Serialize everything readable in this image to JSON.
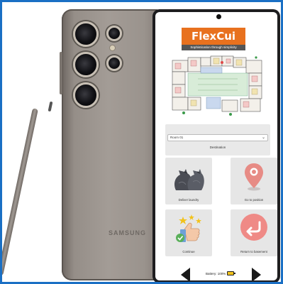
{
  "device": {
    "brand_text": "SAMSUNG"
  },
  "app": {
    "logo": {
      "title": "FlexCui",
      "tagline": "Sophistication through simplicity",
      "accent": "#e8711e"
    },
    "destination": {
      "selected": "Room 01",
      "label": "Destination"
    },
    "tiles": [
      {
        "label": "Deliver laundry",
        "icon": "laundry-bags-icon"
      },
      {
        "label": "Go to position",
        "icon": "location-pin-icon"
      },
      {
        "label": "Continue",
        "icon": "thumbs-up-stars-icon"
      },
      {
        "label": "Return to basement",
        "icon": "return-arrow-icon"
      }
    ],
    "footer": {
      "battery_text": "Battery: 100%",
      "battery_level": 1.0
    }
  },
  "colors": {
    "frame_border": "#1a6fc4",
    "pin_color": "#e78b85",
    "return_circle": "#ef8a86"
  }
}
